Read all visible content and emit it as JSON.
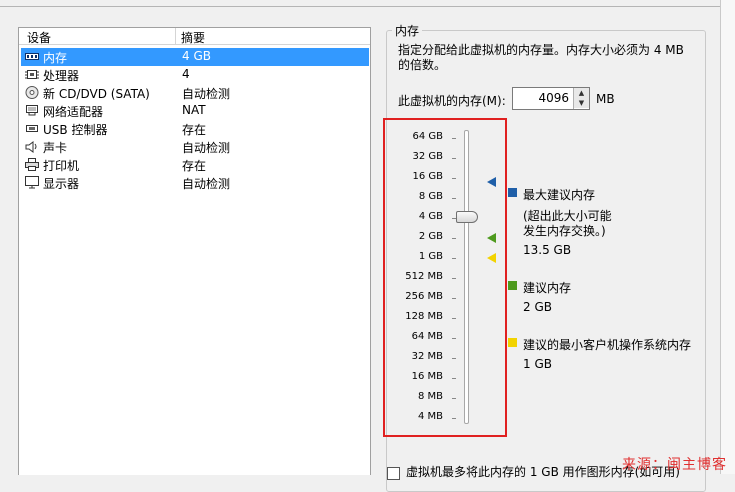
{
  "device_list": {
    "headers": {
      "device": "设备",
      "summary": "摘要"
    },
    "rows": [
      {
        "name": "内存",
        "summary": "4 GB",
        "icon": "memory-icon"
      },
      {
        "name": "处理器",
        "summary": "4",
        "icon": "cpu-icon"
      },
      {
        "name": "新 CD/DVD (SATA)",
        "summary": "自动检测",
        "icon": "cd-icon"
      },
      {
        "name": "网络适配器",
        "summary": "NAT",
        "icon": "network-icon"
      },
      {
        "name": "USB 控制器",
        "summary": "存在",
        "icon": "usb-icon"
      },
      {
        "name": "声卡",
        "summary": "自动检测",
        "icon": "sound-icon"
      },
      {
        "name": "打印机",
        "summary": "存在",
        "icon": "printer-icon"
      },
      {
        "name": "显示器",
        "summary": "自动检测",
        "icon": "display-icon"
      }
    ],
    "selected_index": 0
  },
  "memory": {
    "group_title": "内存",
    "description": "指定分配给此虚拟机的内存量。内存大小必须为 4 MB 的倍数。",
    "size_label": "此虚拟机的内存(M):",
    "size_value": "4096",
    "unit": "MB",
    "ticks": [
      "64 GB",
      "32 GB",
      "16 GB",
      "8 GB",
      "4 GB",
      "2 GB",
      "1 GB",
      "512 MB",
      "256 MB",
      "128 MB",
      "64 MB",
      "32 MB",
      "16 MB",
      "8 MB",
      "4 MB"
    ],
    "slider_value": "4 GB",
    "legend": {
      "max": {
        "label": "最大建议内存",
        "note1": "(超出此大小可能",
        "note2": "发生内存交换。)",
        "value": "13.5 GB",
        "color": "#1f5fa8"
      },
      "recommended": {
        "label": "建议内存",
        "value": "2 GB",
        "color": "#4e9a1e"
      },
      "min_guest": {
        "label": "建议的最小客户机操作系统内存",
        "value": "1 GB",
        "color": "#f2d300"
      }
    }
  },
  "bottom": {
    "checkbox_text": "虚拟机最多将此内存的 1 GB 用作图形内存(如可用)"
  },
  "watermark": "来源：闽主博客",
  "colors": {
    "selection": "#3399ff",
    "highlight_box": "#e02020"
  }
}
